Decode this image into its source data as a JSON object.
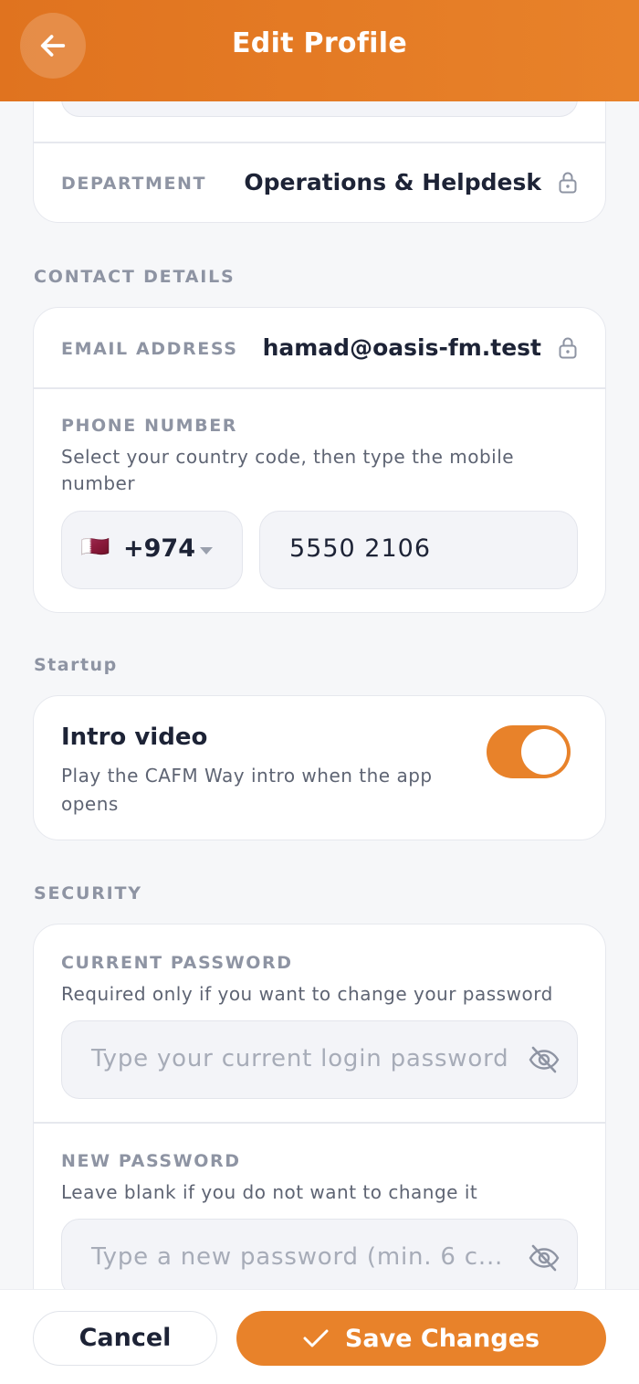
{
  "header": {
    "title": "Edit Profile"
  },
  "organisation": {
    "department_label": "DEPARTMENT",
    "department_value": "Operations & Helpdesk"
  },
  "contact": {
    "section_title": "CONTACT DETAILS",
    "email_label": "EMAIL ADDRESS",
    "email_value": "hamad@oasis-fm.test",
    "phone_label": "PHONE NUMBER",
    "phone_helper": "Select your country code, then type the mobile number",
    "country_code": "+974",
    "country_flag": "🇶🇦",
    "phone_value": "5550 2106"
  },
  "startup": {
    "section_title": "Startup",
    "intro_title": "Intro video",
    "intro_helper": "Play the CAFM Way intro when the app opens",
    "intro_enabled": true
  },
  "security": {
    "section_title": "SECURITY",
    "current_label": "CURRENT PASSWORD",
    "current_helper": "Required only if you want to change your password",
    "current_placeholder": "Type your current login password",
    "new_label": "NEW PASSWORD",
    "new_helper": "Leave blank if you do not want to change it",
    "new_placeholder": "Type a new password (min. 6 c..."
  },
  "footer": {
    "cancel_label": "Cancel",
    "save_label": "Save Changes"
  },
  "colors": {
    "accent": "#e8822a",
    "text": "#1d2336",
    "muted": "#8e94a3"
  }
}
